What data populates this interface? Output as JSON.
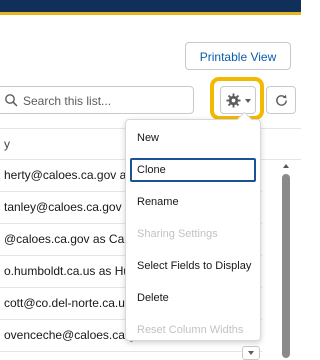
{
  "header": {
    "printable_view_label": "Printable View"
  },
  "list": {
    "search_placeholder": "Search this list...",
    "column_header": "y",
    "rows": [
      "herty@caloes.ca.gov as Cal OES IDO",
      "tanley@caloes.ca.gov as Cal OES IDO",
      "@caloes.ca.gov as Cal OES IDO",
      "o.humboldt.ca.us as Humboldt IDO",
      "cott@co.del-norte.ca.us as Del Norte",
      "ovenceche@caloes.ca.gov as Cal OES IDO"
    ]
  },
  "settings_menu": {
    "items": [
      {
        "label": "New",
        "disabled": false,
        "focused": false
      },
      {
        "label": "Clone",
        "disabled": false,
        "focused": true
      },
      {
        "label": "Rename",
        "disabled": false,
        "focused": false
      },
      {
        "label": "Sharing Settings",
        "disabled": true,
        "focused": false
      },
      {
        "label": "Select Fields to Display",
        "disabled": false,
        "focused": false
      },
      {
        "label": "Delete",
        "disabled": false,
        "focused": false
      },
      {
        "label": "Reset Column Widths",
        "disabled": true,
        "focused": false
      }
    ]
  },
  "icons": {
    "search": "search-icon",
    "gear": "gear-icon",
    "dropdown": "chevron-down-icon",
    "refresh": "refresh-icon"
  },
  "colors": {
    "header_navy": "#10305a",
    "header_accent": "#e8b31f",
    "highlight": "#f5b800",
    "link_blue": "#0b5cab",
    "focus_border": "#1b5297"
  }
}
